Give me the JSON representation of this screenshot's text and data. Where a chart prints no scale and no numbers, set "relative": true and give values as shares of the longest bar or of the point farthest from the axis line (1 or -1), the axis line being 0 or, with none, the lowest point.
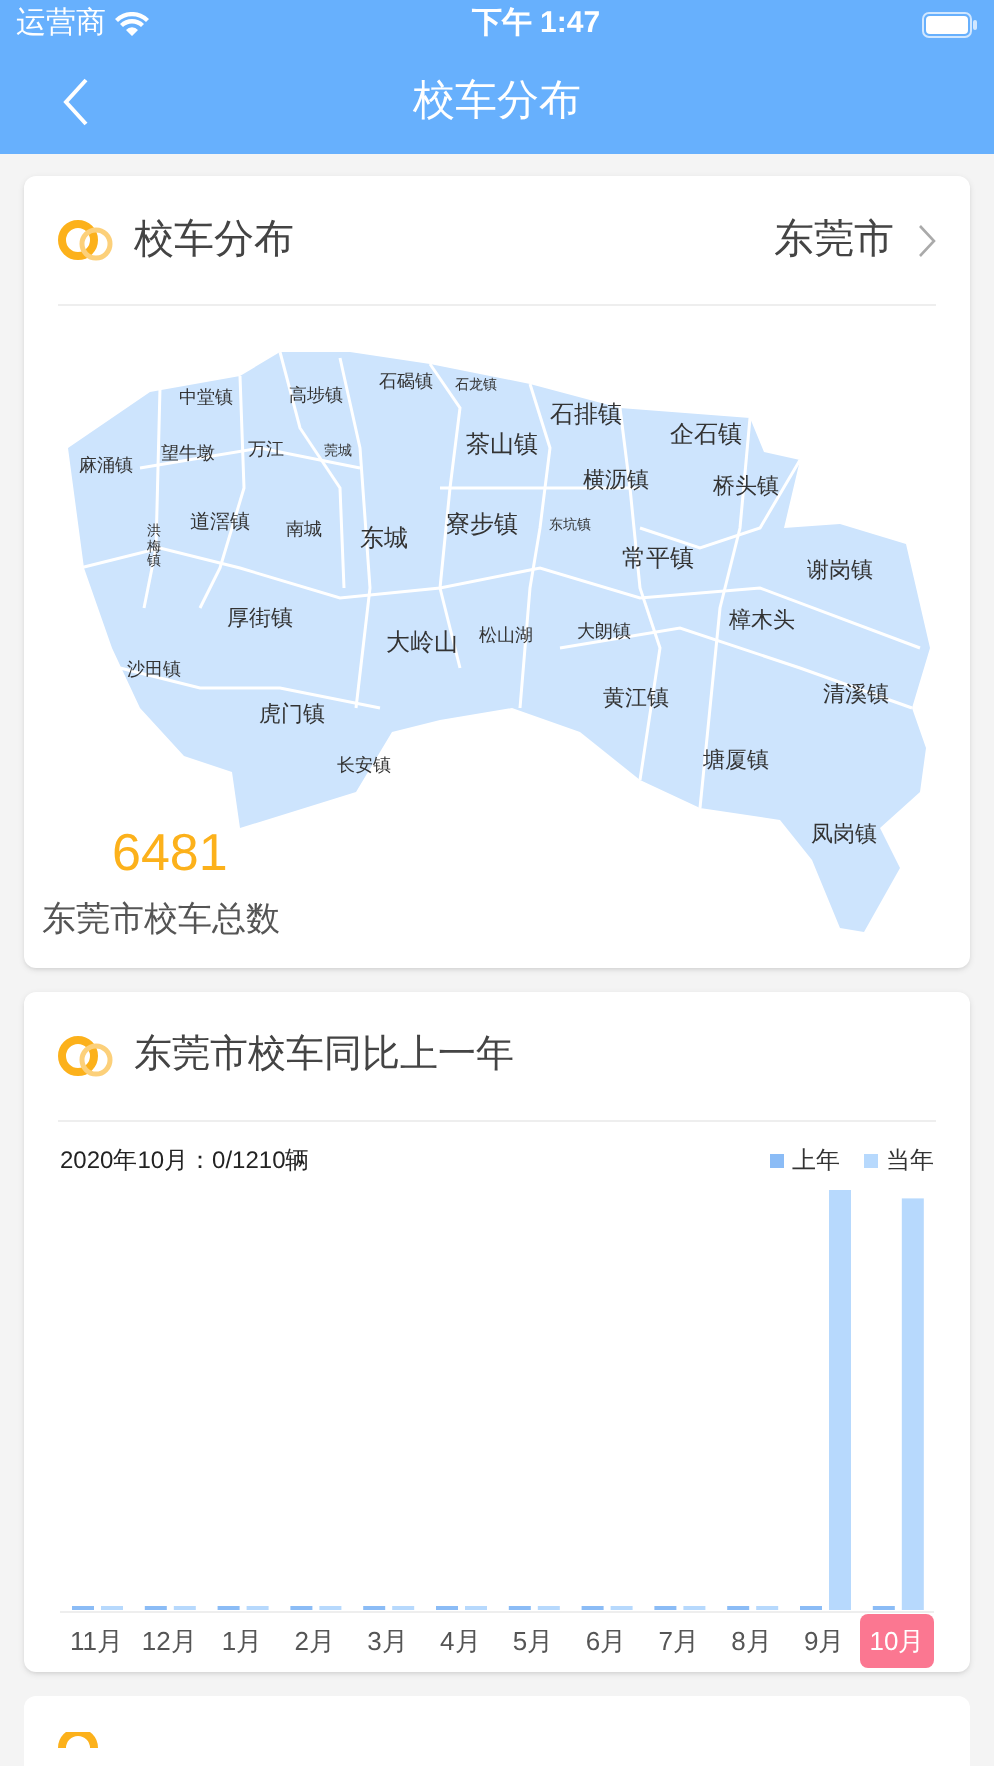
{
  "status_bar": {
    "carrier": "运营商",
    "time": "下午 1:47"
  },
  "nav": {
    "title": "校车分布"
  },
  "distribution_card": {
    "title": "校车分布",
    "city": "东莞市",
    "towns": [
      "中堂镇",
      "高埗镇",
      "石碣镇",
      "石龙镇",
      "石排镇",
      "企石镇",
      "麻涌镇",
      "望牛墩",
      "万江",
      "莞城",
      "茶山镇",
      "横沥镇",
      "桥头镇",
      "洪梅镇",
      "道滘镇",
      "南城",
      "东城",
      "寮步镇",
      "东坑镇",
      "常平镇",
      "谢岗镇",
      "厚街镇",
      "大岭山",
      "松山湖",
      "大朗镇",
      "樟木头",
      "沙田镇",
      "黄江镇",
      "清溪镇",
      "虎门镇",
      "长安镇",
      "塘厦镇",
      "凤岗镇"
    ],
    "total": "6481",
    "total_label": "东莞市校车总数"
  },
  "compare_card": {
    "title": "东莞市校车同比上一年",
    "summary": "2020年10月：0/1210辆",
    "chart_data": {
      "type": "bar",
      "relative": true,
      "categories": [
        "11月",
        "12月",
        "1月",
        "2月",
        "3月",
        "4月",
        "5月",
        "6月",
        "7月",
        "8月",
        "9月",
        "10月"
      ],
      "series": [
        {
          "name": "上年",
          "color": "#8bbcf6",
          "values": [
            0,
            0,
            0,
            0,
            0,
            0,
            0,
            0,
            0,
            0,
            0,
            0
          ]
        },
        {
          "name": "当年",
          "color": "#b7d9fd",
          "values": [
            0,
            0,
            0,
            0,
            0,
            0,
            0,
            0,
            0,
            0,
            1,
            0.98
          ]
        }
      ]
    },
    "month_tabs": [
      {
        "selected": false
      },
      {
        "selected": false
      },
      {
        "selected": false
      },
      {
        "selected": false
      },
      {
        "selected": false
      },
      {
        "selected": false
      },
      {
        "selected": false
      },
      {
        "selected": false
      },
      {
        "selected": false
      },
      {
        "selected": false
      },
      {
        "selected": false
      },
      {
        "selected": true
      }
    ]
  }
}
